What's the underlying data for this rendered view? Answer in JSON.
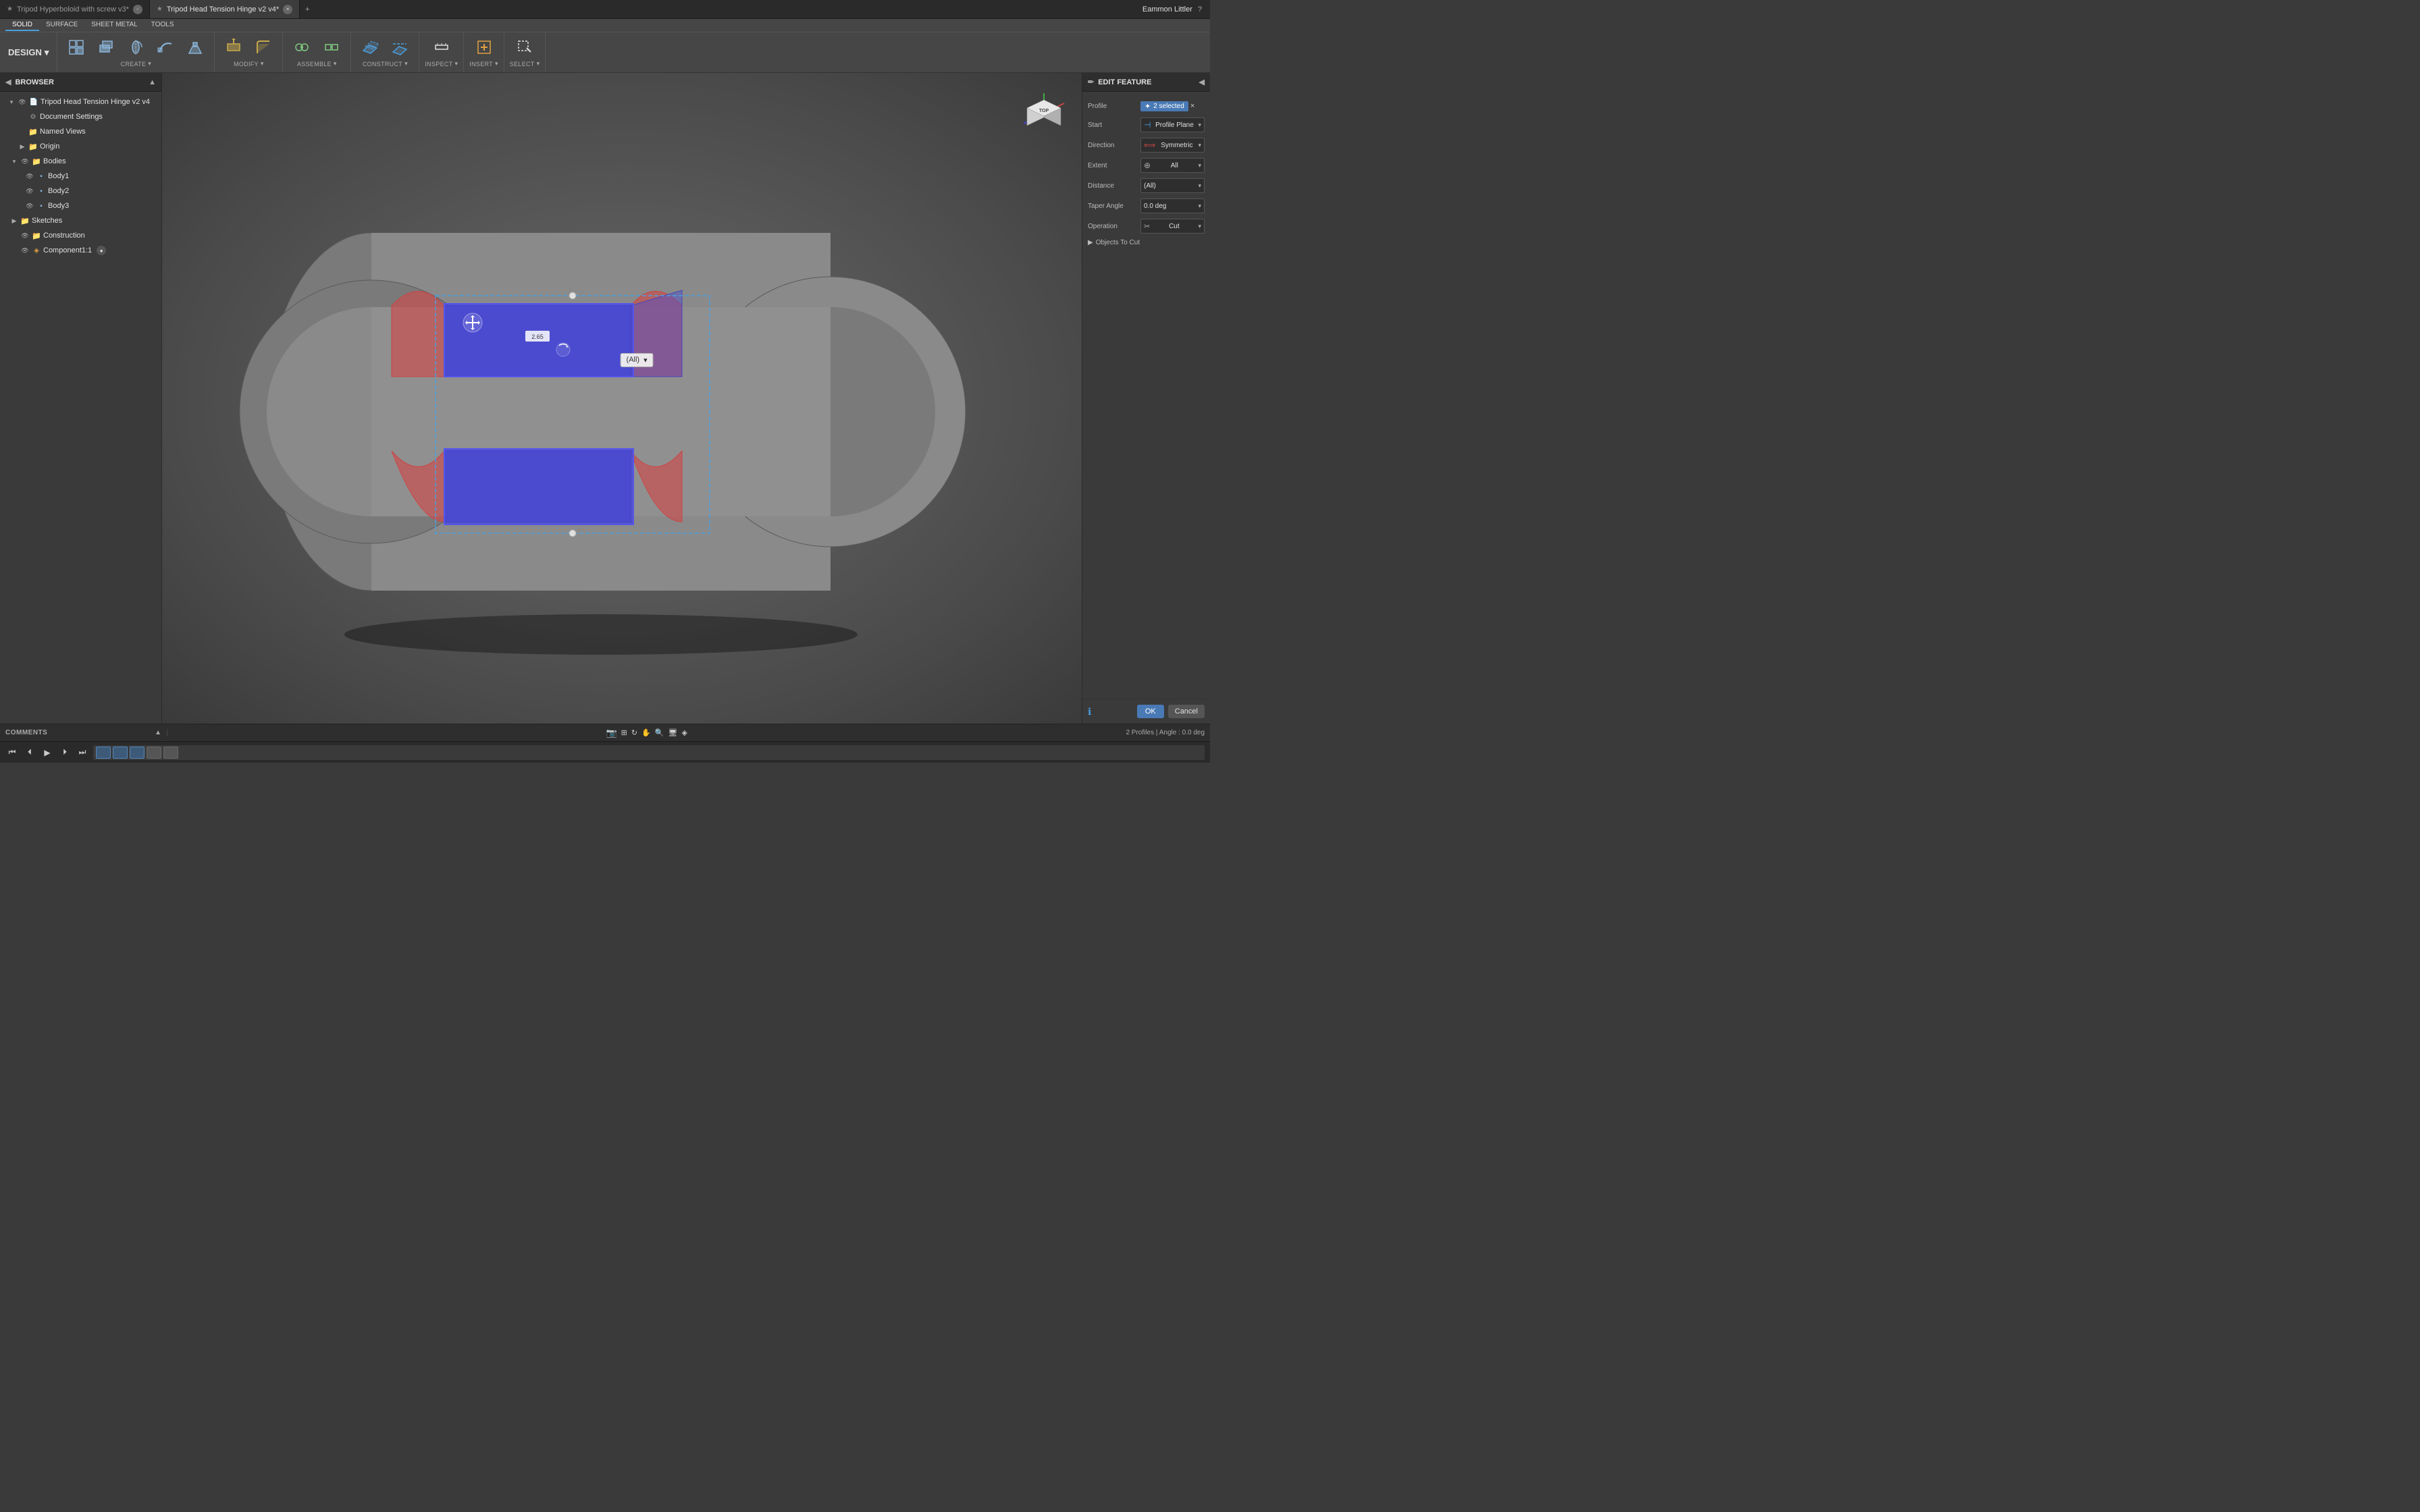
{
  "titlebar": {
    "tabs": [
      {
        "id": "tab1",
        "label": "Tripod Hyperboloid with screw v3*",
        "icon": "★",
        "active": false
      },
      {
        "id": "tab2",
        "label": "Tripod Head Tension Hinge v2 v4*",
        "icon": "★",
        "active": true
      }
    ],
    "user": "Eammon Littler",
    "new_tab_icon": "+",
    "close_icon": "×",
    "help_icon": "?",
    "settings_icon": "⚙"
  },
  "quick_access": {
    "grid_icon": "⊞",
    "save_icon": "💾",
    "undo_icon": "↩",
    "redo_icon": "↪",
    "more_icon": "▾"
  },
  "toolbar": {
    "design_label": "DESIGN",
    "design_arrow": "▾",
    "tabs": [
      "SOLID",
      "SURFACE",
      "SHEET METAL",
      "TOOLS"
    ],
    "active_tab": "SOLID",
    "groups": [
      {
        "id": "create",
        "label": "CREATE",
        "has_arrow": true,
        "items": [
          {
            "id": "new-component",
            "icon": "⬚",
            "label": ""
          },
          {
            "id": "extrude",
            "icon": "⬜",
            "label": ""
          },
          {
            "id": "revolve",
            "icon": "◕",
            "label": ""
          },
          {
            "id": "sweep",
            "icon": "⟳",
            "label": ""
          },
          {
            "id": "loft",
            "icon": "◈",
            "label": ""
          }
        ]
      },
      {
        "id": "modify",
        "label": "MODIFY",
        "has_arrow": true,
        "items": [
          {
            "id": "press-pull",
            "icon": "⤡",
            "label": ""
          },
          {
            "id": "fillet",
            "icon": "ƒ",
            "label": ""
          }
        ]
      },
      {
        "id": "assemble",
        "label": "ASSEMBLE",
        "has_arrow": true,
        "items": [
          {
            "id": "joint",
            "icon": "⚙",
            "label": ""
          },
          {
            "id": "as-built",
            "icon": "⚙",
            "label": ""
          }
        ]
      },
      {
        "id": "construct",
        "label": "CONSTRUCT",
        "has_arrow": true,
        "items": [
          {
            "id": "offset-plane",
            "icon": "▭",
            "label": ""
          },
          {
            "id": "midplane",
            "icon": "▭",
            "label": ""
          }
        ]
      },
      {
        "id": "inspect",
        "label": "INSPECT",
        "has_arrow": true,
        "items": []
      },
      {
        "id": "insert",
        "label": "INSERT",
        "has_arrow": true,
        "items": []
      },
      {
        "id": "select",
        "label": "SELECT",
        "has_arrow": true,
        "items": []
      }
    ]
  },
  "browser": {
    "title": "BROWSER",
    "collapse_icon": "◀",
    "items": [
      {
        "id": "root",
        "indent": 0,
        "arrow": "▾",
        "vis": true,
        "icon": "doc",
        "label": "Tripod Head Tension Hinge v2 v4",
        "has_eye": false
      },
      {
        "id": "doc-settings",
        "indent": 1,
        "arrow": "",
        "vis": false,
        "icon": "gear",
        "label": "Document Settings",
        "has_eye": false
      },
      {
        "id": "named-views",
        "indent": 1,
        "arrow": "",
        "vis": false,
        "icon": "folder",
        "label": "Named Views",
        "has_eye": false
      },
      {
        "id": "origin",
        "indent": 1,
        "arrow": "▶",
        "vis": false,
        "icon": "folder",
        "label": "Origin",
        "has_eye": false
      },
      {
        "id": "bodies",
        "indent": 1,
        "arrow": "▾",
        "vis": true,
        "icon": "folder",
        "label": "Bodies",
        "has_eye": true
      },
      {
        "id": "body1",
        "indent": 2,
        "arrow": "",
        "vis": false,
        "icon": "cube",
        "label": "Body1",
        "has_eye": true
      },
      {
        "id": "body2",
        "indent": 2,
        "arrow": "",
        "vis": false,
        "icon": "cube",
        "label": "Body2",
        "has_eye": true
      },
      {
        "id": "body3",
        "indent": 2,
        "arrow": "",
        "vis": false,
        "icon": "cube",
        "label": "Body3",
        "has_eye": true
      },
      {
        "id": "sketches",
        "indent": 1,
        "arrow": "▶",
        "vis": false,
        "icon": "folder",
        "label": "Sketches",
        "has_eye": false
      },
      {
        "id": "construction",
        "indent": 1,
        "arrow": "",
        "vis": true,
        "icon": "folder",
        "label": "Construction",
        "has_eye": true
      },
      {
        "id": "component1",
        "indent": 1,
        "arrow": "",
        "vis": true,
        "icon": "component",
        "label": "Component1:1",
        "has_eye": true
      }
    ]
  },
  "viewport": {
    "extrude_popup": {
      "label": "(All)",
      "dropdown_arrow": "▾"
    },
    "dimension_label": "2.65",
    "plane_lines_visible": true
  },
  "edit_feature": {
    "title": "EDIT FEATURE",
    "expand_icon": "◀",
    "rows": [
      {
        "id": "profile",
        "label": "Profile",
        "type": "badge",
        "badge_text": "2 selected",
        "has_x": true
      },
      {
        "id": "start",
        "label": "Start",
        "type": "select",
        "value": "Profile Plane",
        "icon": "⊣"
      },
      {
        "id": "direction",
        "label": "Direction",
        "type": "select",
        "value": "Symmetric",
        "icon": "⟺"
      },
      {
        "id": "extent",
        "label": "Extent",
        "type": "select",
        "value": "All",
        "icon": "⊕"
      },
      {
        "id": "distance",
        "label": "Distance",
        "type": "select",
        "value": "(All)",
        "icon": ""
      },
      {
        "id": "taper-angle",
        "label": "Taper Angle",
        "type": "select",
        "value": "0.0 deg",
        "icon": ""
      },
      {
        "id": "operation",
        "label": "Operation",
        "type": "select",
        "value": "Cut",
        "icon": "✂"
      }
    ],
    "objects_to_cut": "Objects To Cut",
    "objects_arrow": "▶",
    "info_icon": "ℹ",
    "ok_label": "OK",
    "cancel_label": "Cancel"
  },
  "statusbar": {
    "comments_label": "COMMENTS",
    "collapse_icon": "▲",
    "status_text": "2 Profiles | Angle : 0.0 deg",
    "view_controls": [
      "grid",
      "orbit",
      "pan",
      "zoom",
      "display",
      "visual-style",
      "environment"
    ]
  },
  "playback": {
    "rewind_icon": "⏮",
    "prev_icon": "⏴",
    "play_icon": "▶",
    "next_icon": "⏵",
    "end_icon": "⏭",
    "thumbnails": [
      {
        "active": true
      },
      {
        "active": true
      },
      {
        "active": true
      },
      {
        "active": false
      },
      {
        "active": false
      }
    ]
  },
  "viewcube": {
    "label": "TOP",
    "color_x": "#cc4444",
    "color_y": "#44aa44",
    "color_z": "#4444cc"
  }
}
